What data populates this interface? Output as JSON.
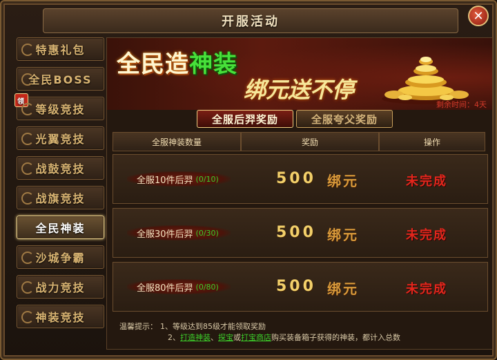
{
  "window": {
    "title": "开服活动",
    "close_label": "✕"
  },
  "sidebar": {
    "items": [
      {
        "label": "特惠礼包"
      },
      {
        "label": "全民BOSS"
      },
      {
        "label": "等级竞技",
        "badge": "领"
      },
      {
        "label": "光翼竞技"
      },
      {
        "label": "战鼓竞技"
      },
      {
        "label": "战旗竞技"
      },
      {
        "label": "全民神装",
        "active": true
      },
      {
        "label": "沙城争霸"
      },
      {
        "label": "战力竞技"
      },
      {
        "label": "神装竞技"
      }
    ]
  },
  "banner": {
    "title_part1": "全民造",
    "title_part2": "神装",
    "subtitle": "绑元送不停",
    "remaining": "剩余时间：4天"
  },
  "tabs": [
    {
      "label": "全服后羿奖励",
      "active": true
    },
    {
      "label": "全服夸父奖励",
      "active": false
    }
  ],
  "table": {
    "headers": [
      "全服神装数量",
      "奖励",
      "操作"
    ],
    "rows": [
      {
        "condition": "全服10件后羿",
        "progress": "(0/10)",
        "amount": "500",
        "unit": "绑元",
        "status": "未完成"
      },
      {
        "condition": "全服30件后羿",
        "progress": "(0/30)",
        "amount": "500",
        "unit": "绑元",
        "status": "未完成"
      },
      {
        "condition": "全服80件后羿",
        "progress": "(0/80)",
        "amount": "500",
        "unit": "绑元",
        "status": "未完成"
      }
    ]
  },
  "tips": {
    "label": "温馨提示：",
    "line1": "1、等级达到85级才能领取奖励",
    "line2_prefix": "2、",
    "link1": "打造神装",
    "sep1": "、",
    "link2": "探宝",
    "sep2": "或",
    "link3": "打宝商店",
    "line2_suffix": "购买装备箱子获得的神装，都计入总数"
  }
}
